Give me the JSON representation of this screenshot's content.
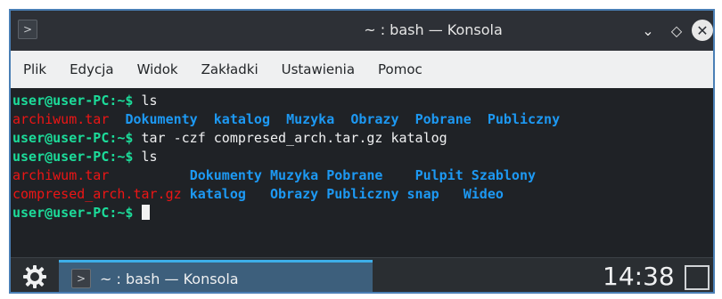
{
  "window": {
    "title": "~ : bash — Konsola",
    "app_icon": "terminal-icon",
    "controls": [
      "chevron-down-icon",
      "pin-icon",
      "close-icon"
    ]
  },
  "menu": {
    "items": [
      "Plik",
      "Edycja",
      "Widok",
      "Zakładki",
      "Ustawienia",
      "Pomoc"
    ]
  },
  "terminal": {
    "prompt": "user@user-PC:~$",
    "commands": [
      "ls",
      "tar -czf compresed_arch.tar.gz katalog",
      "ls"
    ],
    "ls1": {
      "archive": "archiwum.tar",
      "dirs": [
        "Dokumenty",
        "katalog",
        "Muzyka",
        "Obrazy",
        "Pobrane",
        "Publiczny"
      ]
    },
    "ls2": {
      "row1_file": "archiwum.tar",
      "row1_dirs": [
        "Dokumenty",
        "Muzyka",
        "Pobrane",
        "Pulpit",
        "Szablony"
      ],
      "row2_file": "compresed_arch.tar.gz",
      "row2_dirs": [
        "katalog",
        "Obrazy",
        "Publiczny",
        "snap",
        "Wideo"
      ]
    },
    "colors": {
      "prompt": "#1cdc9a",
      "archive": "#ed1515",
      "directory": "#1d99f3",
      "text": "#eff0f1"
    }
  },
  "taskbar": {
    "launcher_icon": "kde-gear-icon",
    "task_label": "~ : bash — Konsola",
    "clock": "14:38",
    "show_desktop_icon": "show-desktop-icon"
  }
}
